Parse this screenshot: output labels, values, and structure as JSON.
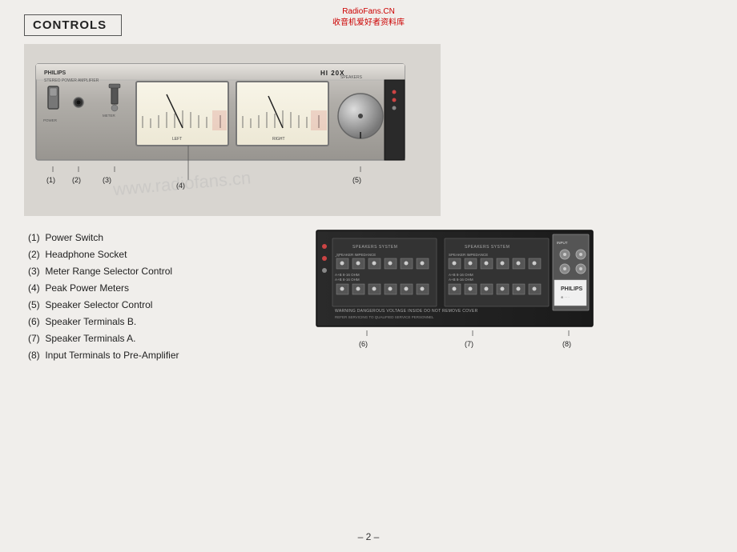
{
  "watermark": {
    "line1": "RadioFans.CN",
    "line2": "收音机爱好者资料库"
  },
  "header": {
    "title": "CONTROLS"
  },
  "controls": {
    "items": [
      {
        "number": "(1)",
        "label": "Power Switch"
      },
      {
        "number": "(2)",
        "label": "Headphone Socket"
      },
      {
        "number": "(3)",
        "label": "Meter Range Selector Control"
      },
      {
        "number": "(4)",
        "label": "Peak Power Meters"
      },
      {
        "number": "(5)",
        "label": "Speaker Selector Control"
      },
      {
        "number": "(6)",
        "label": "Speaker Terminals B."
      },
      {
        "number": "(7)",
        "label": "Speaker Terminals A."
      },
      {
        "number": "(8)",
        "label": "Input Terminals to Pre-Amplifier"
      }
    ]
  },
  "amp_front": {
    "brand": "PHILIPS",
    "model": "HI 20X",
    "label1": "(1)",
    "label2": "(2)",
    "label3": "(3)",
    "label4": "(4)",
    "label5": "(5)"
  },
  "amp_rear": {
    "label6": "(6)",
    "label7": "(7)",
    "label8": "(8)",
    "warning": "WARNING  DANGEROUS VOLTAGE INSIDE  DO NOT REMOVE COVER"
  },
  "page": {
    "number": "– 2 –"
  }
}
